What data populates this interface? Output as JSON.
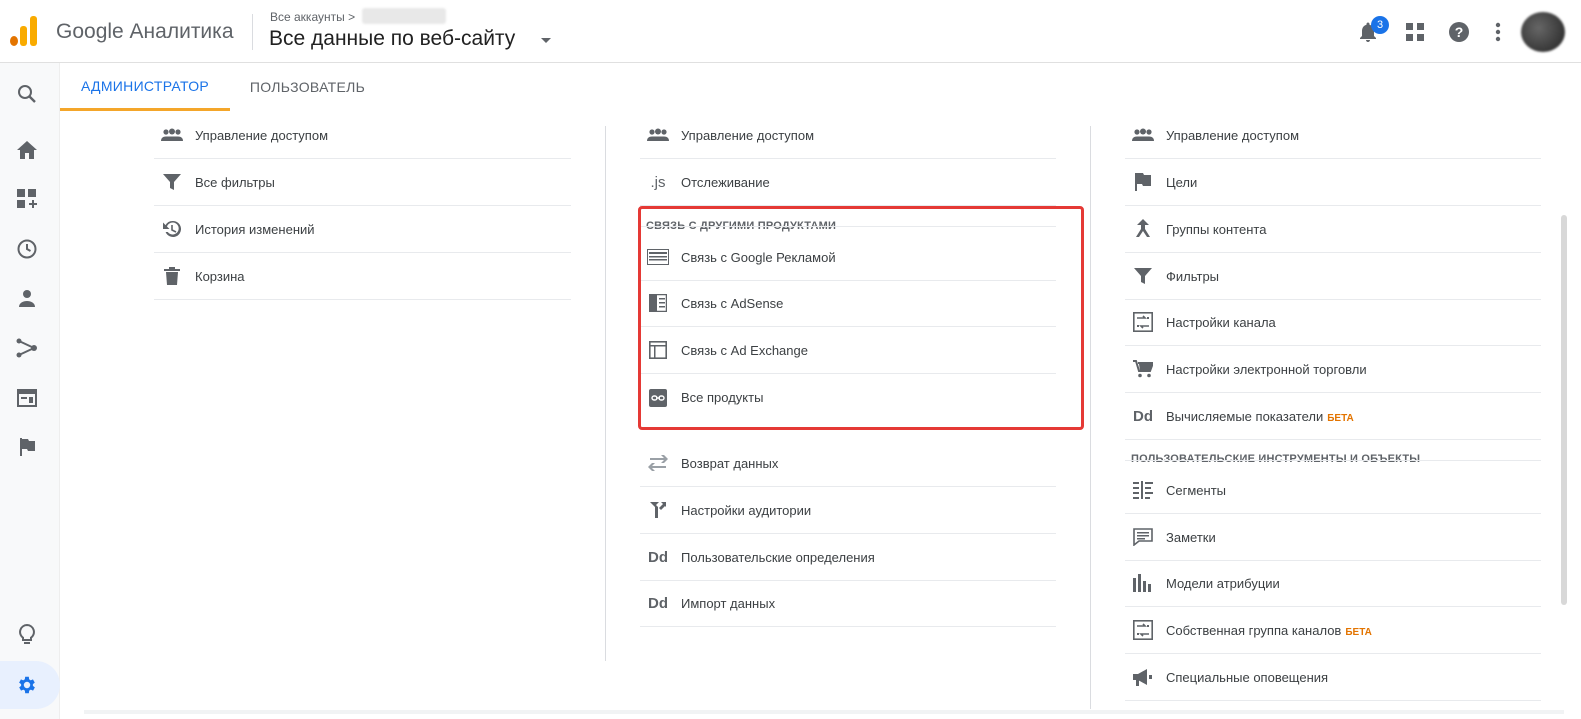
{
  "header": {
    "brand": "Google Аналитика",
    "breadcrumb": "Все аккаунты >",
    "view_title": "Все данные по веб-сайту",
    "notification_count": "3"
  },
  "tabs": [
    {
      "label": "АДМИНИСТРАТОР"
    },
    {
      "label": "ПОЛЬЗОВАТЕЛЬ"
    }
  ],
  "account_column": {
    "items": [
      {
        "label": "Управление доступом",
        "icon": "people-icon"
      },
      {
        "label": "Все фильтры",
        "icon": "filter-icon"
      },
      {
        "label": "История изменений",
        "icon": "history-icon"
      },
      {
        "label": "Корзина",
        "icon": "trash-icon"
      }
    ]
  },
  "property_column": {
    "top_items": [
      {
        "label": "Управление доступом",
        "icon": "people-icon"
      },
      {
        "label": "Отслеживание",
        "icon": "js-icon",
        "glyph": ".js"
      }
    ],
    "linking_section": {
      "title": "СВЯЗЬ С ДРУГИМИ ПРОДУКТАМИ",
      "items": [
        {
          "label": "Связь с Google Рекламой",
          "icon": "ads-icon"
        },
        {
          "label": "Связь с AdSense",
          "icon": "adsense-icon"
        },
        {
          "label": "Связь с Ad Exchange",
          "icon": "adexchange-icon"
        },
        {
          "label": "Все продукты",
          "icon": "link-icon"
        }
      ]
    },
    "bottom_items": [
      {
        "label": "Возврат данных",
        "icon": "swap-icon"
      },
      {
        "label": "Настройки аудитории",
        "icon": "audience-icon"
      },
      {
        "label": "Пользовательские определения",
        "icon": "dd-icon",
        "glyph": "Dd"
      },
      {
        "label": "Импорт данных",
        "icon": "dd-icon",
        "glyph": "Dd"
      }
    ]
  },
  "view_column": {
    "items": [
      {
        "label": "Управление доступом",
        "icon": "people-icon"
      },
      {
        "label": "Цели",
        "icon": "flag-icon"
      },
      {
        "label": "Группы контента",
        "icon": "content-group-icon"
      },
      {
        "label": "Фильтры",
        "icon": "filter-icon"
      },
      {
        "label": "Настройки канала",
        "icon": "channel-icon"
      },
      {
        "label": "Настройки электронной торговли",
        "icon": "cart-icon"
      },
      {
        "label": "Вычисляемые показатели",
        "icon": "dd-icon",
        "glyph": "Dd",
        "badge": "БЕТА"
      }
    ],
    "tools_section": {
      "title": "ПОЛЬЗОВАТЕЛЬСКИЕ ИНСТРУМЕНТЫ И ОБЪЕКТЫ",
      "items": [
        {
          "label": "Сегменты",
          "icon": "segments-icon"
        },
        {
          "label": "Заметки",
          "icon": "annotation-icon"
        },
        {
          "label": "Модели атрибуции",
          "icon": "attribution-icon"
        },
        {
          "label": "Собственная группа каналов",
          "icon": "channel-icon",
          "badge": "БЕТА"
        },
        {
          "label": "Специальные оповещения",
          "icon": "megaphone-icon"
        }
      ]
    }
  },
  "colors": {
    "accent": "#1a73e8",
    "tab_underline": "#f4a62a",
    "highlight_box": "#e53935",
    "beta": "#e37400"
  }
}
